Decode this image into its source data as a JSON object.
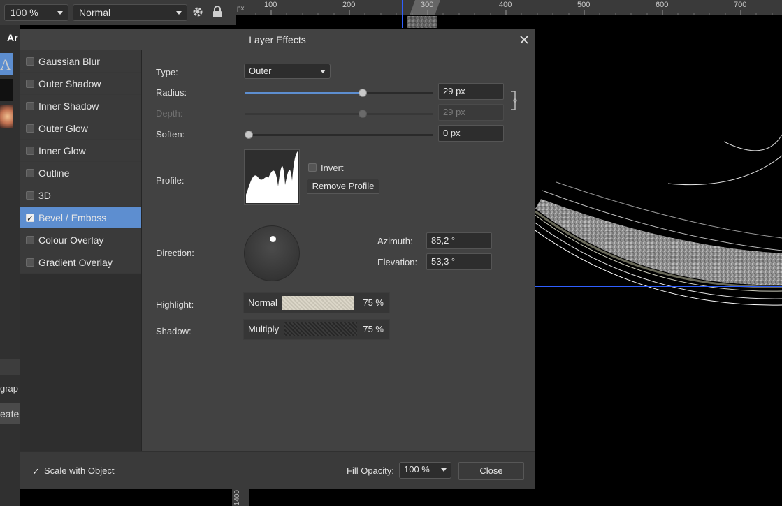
{
  "toolbar": {
    "zoom": "100 %",
    "blend_mode": "Normal"
  },
  "ruler": {
    "unit": "px",
    "ticks": [
      "100",
      "200",
      "300",
      "400",
      "500",
      "600",
      "700"
    ],
    "left_label": "1400"
  },
  "left_panel": {
    "partial_title": "Ar",
    "partial_graph": "grap",
    "partial_create": "eate"
  },
  "dialog": {
    "title": "Layer Effects",
    "effects": [
      {
        "label": "Gaussian Blur",
        "checked": false,
        "selected": false
      },
      {
        "label": "Outer Shadow",
        "checked": false,
        "selected": false
      },
      {
        "label": "Inner Shadow",
        "checked": false,
        "selected": false
      },
      {
        "label": "Outer Glow",
        "checked": false,
        "selected": false
      },
      {
        "label": "Inner Glow",
        "checked": false,
        "selected": false
      },
      {
        "label": "Outline",
        "checked": false,
        "selected": false
      },
      {
        "label": "3D",
        "checked": false,
        "selected": false
      },
      {
        "label": "Bevel / Emboss",
        "checked": true,
        "selected": true
      },
      {
        "label": "Colour Overlay",
        "checked": false,
        "selected": false
      },
      {
        "label": "Gradient Overlay",
        "checked": false,
        "selected": false
      }
    ],
    "settings": {
      "type_label": "Type:",
      "type_value": "Outer",
      "radius_label": "Radius:",
      "radius_value": "29 px",
      "radius_fraction": 0.63,
      "depth_label": "Depth:",
      "depth_value": "29 px",
      "depth_fraction": 0.63,
      "soften_label": "Soften:",
      "soften_value": "0 px",
      "soften_fraction": 0.0,
      "profile_label": "Profile:",
      "invert_label": "Invert",
      "remove_profile_label": "Remove Profile",
      "direction_label": "Direction:",
      "azimuth_label": "Azimuth:",
      "azimuth_value": "85,2 °",
      "elevation_label": "Elevation:",
      "elevation_value": "53,3 °",
      "highlight_label": "Highlight:",
      "highlight_mode": "Normal",
      "highlight_opacity": "75 %",
      "highlight_color": "#d9d4c4",
      "shadow_label": "Shadow:",
      "shadow_mode": "Multiply",
      "shadow_opacity": "75 %",
      "shadow_color": "#2a2a2a"
    },
    "footer": {
      "scale_label": "Scale with Object",
      "fill_opacity_label": "Fill Opacity:",
      "fill_opacity_value": "100 %",
      "close_label": "Close"
    }
  },
  "colors": {
    "accent": "#5d8ed0",
    "guide": "#2f5fff"
  }
}
